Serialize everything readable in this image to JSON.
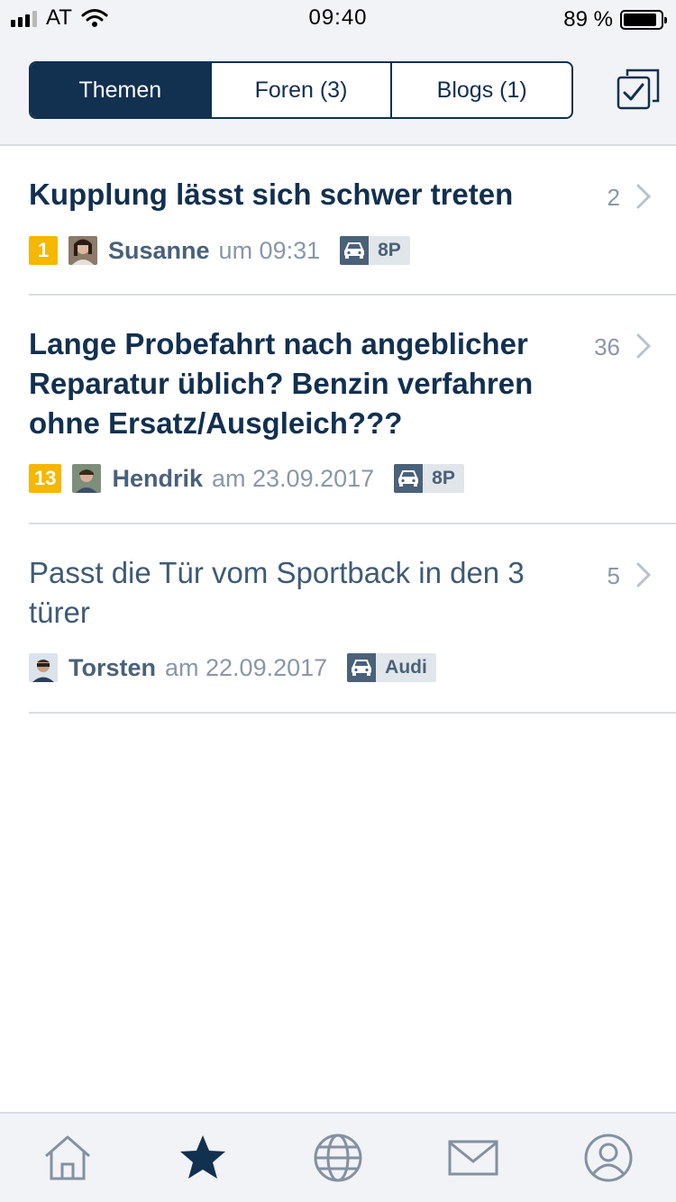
{
  "status": {
    "carrier": "AT",
    "time": "09:40",
    "battery": "89 %",
    "battery_level": 0.89
  },
  "segments": [
    {
      "label": "Themen",
      "active": true
    },
    {
      "label": "Foren (3)",
      "active": false
    },
    {
      "label": "Blogs (1)",
      "active": false
    }
  ],
  "threads": [
    {
      "title": "Kupplung lässt sich schwer treten",
      "count": "2",
      "badge": "1",
      "author": "Susanne",
      "when": "um 09:31",
      "tag": "8P",
      "unread": true
    },
    {
      "title": "Lange Probefahrt nach angeblicher Reparatur üblich? Benzin verfahren ohne Ersatz/Ausgleich???",
      "count": "36",
      "badge": "13",
      "author": "Hendrik",
      "when": "am 23.09.2017",
      "tag": "8P",
      "unread": true
    },
    {
      "title": "Passt die Tür vom Sportback in den 3 türer",
      "count": "5",
      "badge": "",
      "author": "Torsten",
      "when": "am 22.09.2017",
      "tag": "Audi",
      "unread": false
    }
  ],
  "tabbar": {
    "items": [
      "home-icon",
      "star-icon",
      "globe-icon",
      "mail-icon",
      "profile-icon"
    ],
    "active": "star-icon"
  },
  "colors": {
    "primary": "#12304f",
    "badge": "#f5b700",
    "muted": "#8a97a6",
    "background": "#f2f3f6"
  }
}
